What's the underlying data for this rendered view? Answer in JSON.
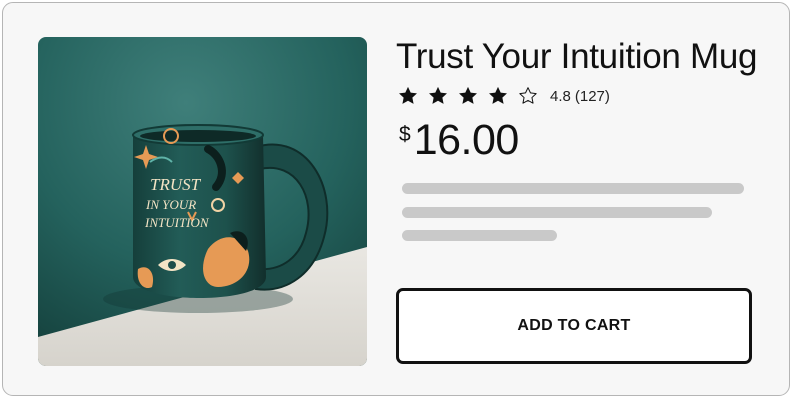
{
  "product": {
    "title": "Trust Your Intuition Mug",
    "image_alt": "Trust Your Intuition Mug",
    "mug_print": [
      "TRUST",
      "IN YOUR",
      "INTUITION"
    ],
    "rating": {
      "value": 4.8,
      "value_text": "4.8",
      "count_text": "(127)",
      "stars_filled": 4,
      "stars_total": 5
    },
    "price": {
      "currency": "$",
      "amount": "16.00"
    },
    "add_to_cart_label": "ADD TO CART"
  },
  "colors": {
    "card_background": "#f7f7f7",
    "card_border": "#b5b5b5",
    "text": "#111111",
    "skeleton": "#c9c9c9",
    "image_background": "#1f5a56",
    "mug": "#1e4e4a",
    "mug_accent": "#e69a55"
  },
  "icons": {
    "star_filled": "star-filled-icon",
    "star_empty": "star-empty-icon"
  }
}
